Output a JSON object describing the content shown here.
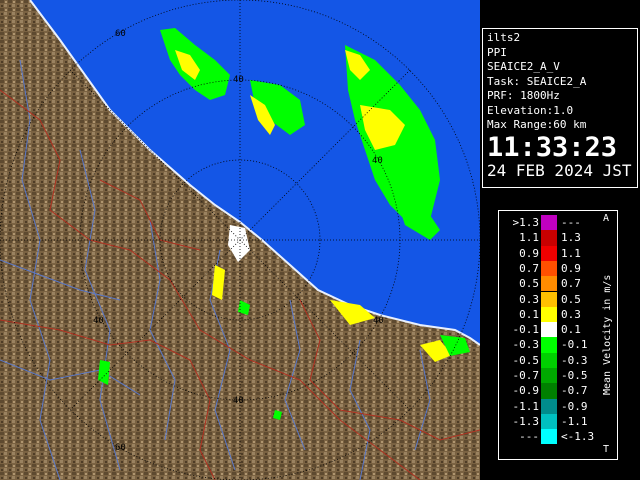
{
  "info": {
    "site": "ilts2",
    "scan_mode": "PPI",
    "product": "SEAICE2_A_V",
    "task": "Task: SEAICE2_A",
    "prf": "PRF: 1800Hz",
    "elevation": "Elevation:1.0",
    "max_range": "Max Range:60 km",
    "time": "11:33:23",
    "date": "24 FEB 2024 JST"
  },
  "legend": {
    "unit_label": "Mean Velocity in m/s",
    "top_mark": "A",
    "bottom_mark": "T",
    "rows": [
      {
        "lo": ">1.3",
        "hi": "---",
        "color": "#c000c0"
      },
      {
        "lo": "1.1",
        "hi": "1.3",
        "color": "#c80000"
      },
      {
        "lo": "0.9",
        "hi": "1.1",
        "color": "#f00000"
      },
      {
        "lo": "0.7",
        "hi": "0.9",
        "color": "#ff5000"
      },
      {
        "lo": "0.5",
        "hi": "0.7",
        "color": "#ff8c00"
      },
      {
        "lo": "0.3",
        "hi": "0.5",
        "color": "#ffc000"
      },
      {
        "lo": "0.1",
        "hi": "0.3",
        "color": "#ffff00"
      },
      {
        "lo": "-0.1",
        "hi": "0.1",
        "color": "#ffffff"
      },
      {
        "lo": "-0.3",
        "hi": "-0.1",
        "color": "#00ff00"
      },
      {
        "lo": "-0.5",
        "hi": "-0.3",
        "color": "#00d000"
      },
      {
        "lo": "-0.7",
        "hi": "-0.5",
        "color": "#00a800"
      },
      {
        "lo": "-0.9",
        "hi": "-0.7",
        "color": "#008000"
      },
      {
        "lo": "-1.1",
        "hi": "-0.9",
        "color": "#008c8c"
      },
      {
        "lo": "-1.3",
        "hi": "-1.1",
        "color": "#00c0c0"
      },
      {
        "lo": "---",
        "hi": "<-1.3",
        "color": "#00ffff"
      }
    ]
  },
  "map": {
    "range_labels": [
      "60",
      "40",
      "40",
      "40",
      "40",
      "60"
    ],
    "sea_color": "#1456e6",
    "land_color": "#7a6242",
    "river_color": "#5a78c8",
    "border_color": "#b03020"
  }
}
